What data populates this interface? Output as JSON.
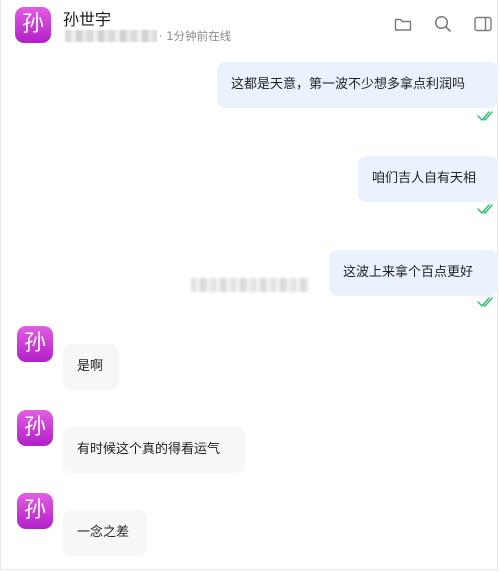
{
  "contact": {
    "avatar_char": "孙",
    "name": "孙世宇",
    "status": "· 1分钟前在线"
  },
  "toolbar": {
    "icons": [
      "folder-icon",
      "search-icon",
      "sidebar-toggle-icon"
    ]
  },
  "messages": [
    {
      "side": "sent",
      "text": "这都是天意，第一波不少想多拿点利润吗",
      "read": true
    },
    {
      "side": "sent",
      "text": "咱们吉人自有天相",
      "read": true
    },
    {
      "side": "sent",
      "text": "这波上来拿个百点更好",
      "read": true
    },
    {
      "side": "received",
      "avatar_char": "孙",
      "text": "是啊"
    },
    {
      "side": "received",
      "avatar_char": "孙",
      "text": "有时候这个真的得看运气"
    },
    {
      "side": "received",
      "avatar_char": "孙",
      "text": "一念之差"
    }
  ],
  "colors": {
    "avatar_gradient_top": "#e25ee2",
    "avatar_gradient_bottom": "#b21fc8",
    "sent_bubble": "#eaf2fd",
    "received_bubble": "#f7f7f7",
    "read_check": "#2cbf6b"
  }
}
